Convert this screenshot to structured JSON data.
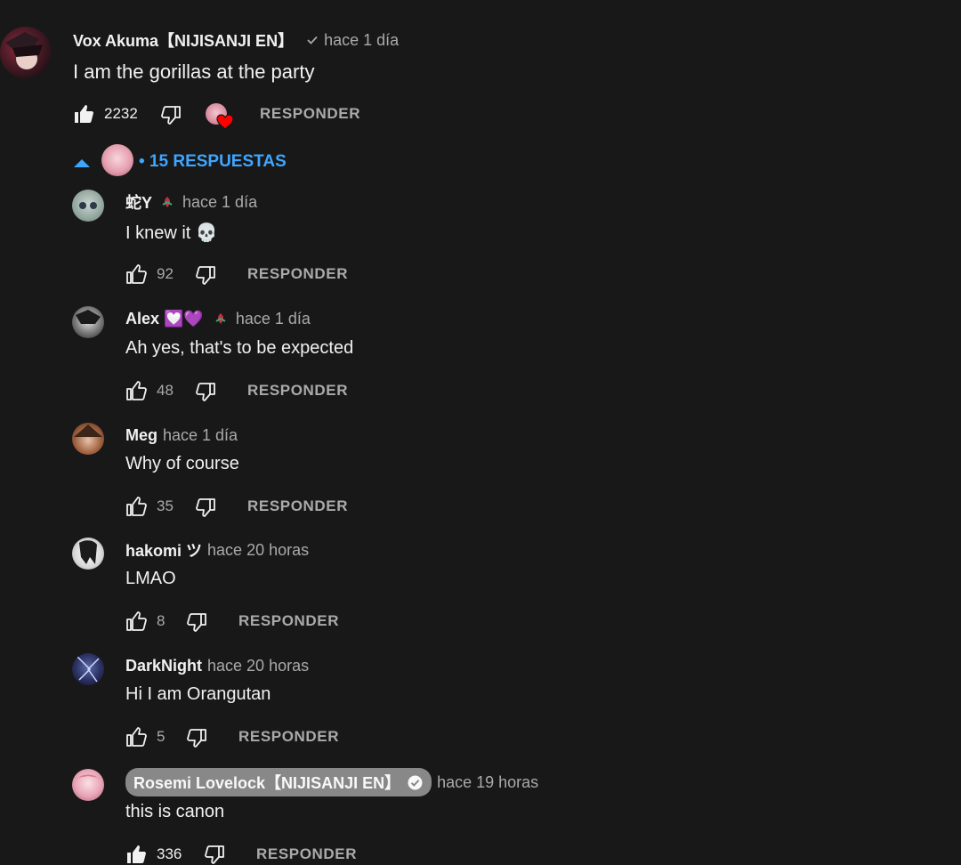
{
  "top_comment": {
    "author": "Vox Akuma【NIJISANJI EN】",
    "time": "hace 1 día",
    "text": "I am the gorillas at the party",
    "likes": "2232",
    "reply_label": "RESPONDER"
  },
  "replies_toggle": {
    "label": "• 15 RESPUESTAS"
  },
  "replies": [
    {
      "author": "蛇Y",
      "time": "hace 1 día",
      "text": "I knew it 💀",
      "likes": "92",
      "reply_label": "RESPONDER"
    },
    {
      "author": "Alex 💟💜",
      "time": "hace 1 día",
      "text": "Ah yes, that's to be expected",
      "likes": "48",
      "reply_label": "RESPONDER"
    },
    {
      "author": "Meg",
      "time": "hace 1 día",
      "text": "Why of course",
      "likes": "35",
      "reply_label": "RESPONDER"
    },
    {
      "author": "hakomi ツ",
      "time": "hace 20 horas",
      "text": "LMAO",
      "likes": "8",
      "reply_label": "RESPONDER"
    },
    {
      "author": "DarkNight",
      "time": "hace 20 horas",
      "text": "Hi I am Orangutan",
      "likes": "5",
      "reply_label": "RESPONDER"
    },
    {
      "author": "Rosemi Lovelock【NIJISANJI EN】",
      "time": "hace 19 horas",
      "text": "this is canon",
      "likes": "336",
      "reply_label": "RESPONDER"
    }
  ],
  "colors": {
    "background": "#181818",
    "link_blue": "#3ea6ff",
    "heart_red": "#ff0000",
    "secondary_text": "#aaaaaa"
  }
}
